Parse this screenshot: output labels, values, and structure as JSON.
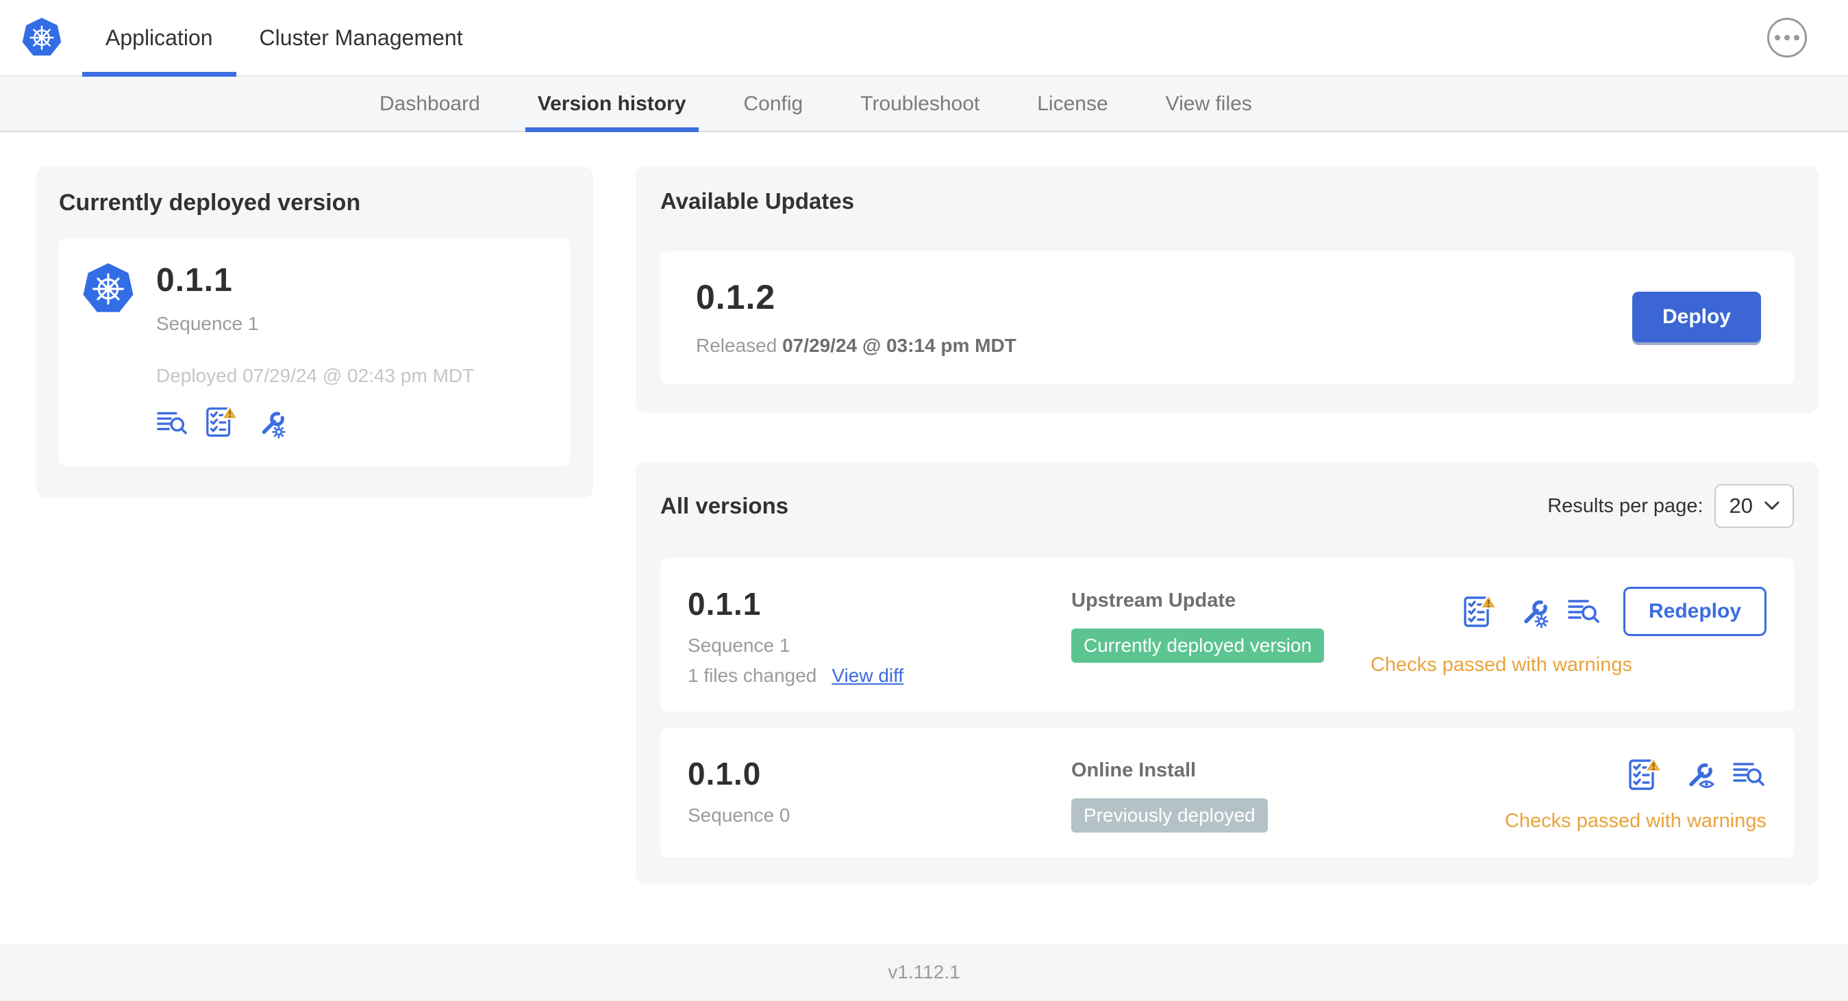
{
  "topbar": {
    "tabs": [
      {
        "label": "Application",
        "active": true
      },
      {
        "label": "Cluster Management",
        "active": false
      }
    ],
    "menu_icon": "ellipsis-circle-icon"
  },
  "subnav": {
    "tabs": [
      {
        "label": "Dashboard",
        "active": false
      },
      {
        "label": "Version history",
        "active": true
      },
      {
        "label": "Config",
        "active": false
      },
      {
        "label": "Troubleshoot",
        "active": false
      },
      {
        "label": "License",
        "active": false
      },
      {
        "label": "View files",
        "active": false
      }
    ]
  },
  "current_version_card": {
    "title": "Currently deployed version",
    "version": "0.1.1",
    "sequence": "Sequence 1",
    "deployed": "Deployed 07/29/24 @ 02:43 pm MDT",
    "icons": [
      "view-files-icon",
      "preflight-checks-warning-icon",
      "edit-config-icon"
    ]
  },
  "available_updates": {
    "title": "Available Updates",
    "version": "0.1.2",
    "released_prefix": "Released",
    "released_date": "07/29/24 @ 03:14 pm MDT",
    "deploy_label": "Deploy"
  },
  "all_versions": {
    "title": "All versions",
    "results_per_page_label": "Results per page:",
    "results_per_page_value": "20",
    "rows": [
      {
        "version": "0.1.1",
        "sequence": "Sequence 1",
        "files_changed": "1 files changed",
        "view_diff_label": "View diff",
        "source": "Upstream Update",
        "badge": "Currently deployed version",
        "badge_color": "#5cc491",
        "icons": [
          "preflight-checks-warning-icon",
          "edit-config-icon",
          "view-files-icon"
        ],
        "action_label": "Redeploy",
        "status": "Checks passed with warnings"
      },
      {
        "version": "0.1.0",
        "sequence": "Sequence 0",
        "source": "Online Install",
        "badge": "Previously deployed",
        "badge_color": "#b4c2c7",
        "icons": [
          "preflight-checks-warning-icon",
          "view-config-icon",
          "view-files-icon"
        ],
        "status": "Checks passed with warnings"
      }
    ]
  },
  "footer": {
    "version": "v1.112.1"
  },
  "colors": {
    "accent_blue": "#3b6ce0",
    "kubernetes_blue": "#326de6",
    "success_badge_green": "#5cc491",
    "neutral_badge_gray": "#b4c2c7",
    "warning_amber": "#e9a33b",
    "panel_gray": "#f4f6f8"
  }
}
